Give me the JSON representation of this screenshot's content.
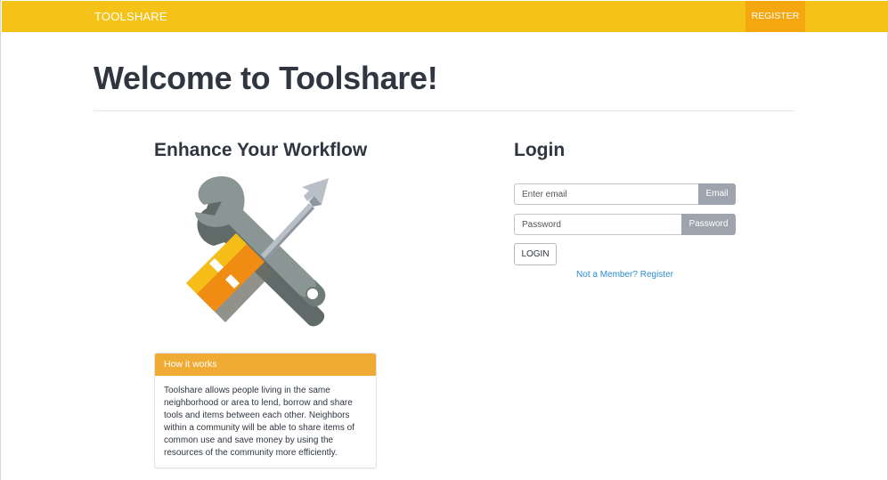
{
  "navbar": {
    "brand": "TOOLSHARE",
    "register_label": "REGISTER",
    "background_color": "#f5c218",
    "register_color": "#f5a70f"
  },
  "page": {
    "title": "Welcome to Toolshare!"
  },
  "left": {
    "heading": "Enhance Your Workflow",
    "illustration_icon": "wrench-and-screwdriver-icon",
    "panel": {
      "heading": "How it works",
      "body": "Toolshare allows people living in the same neighborhood or area to lend, borrow and share tools and items between each other. Neighbors within a community will be able to share items of common use and save money by using the resources of the community more efficiently."
    }
  },
  "login": {
    "heading": "Login",
    "email_placeholder": "Enter email",
    "email_addon": "Email",
    "password_placeholder": "Password",
    "password_addon": "Password",
    "button_label": "LOGIN",
    "register_link": "Not a Member? Register",
    "link_color": "#2b8ed1"
  }
}
